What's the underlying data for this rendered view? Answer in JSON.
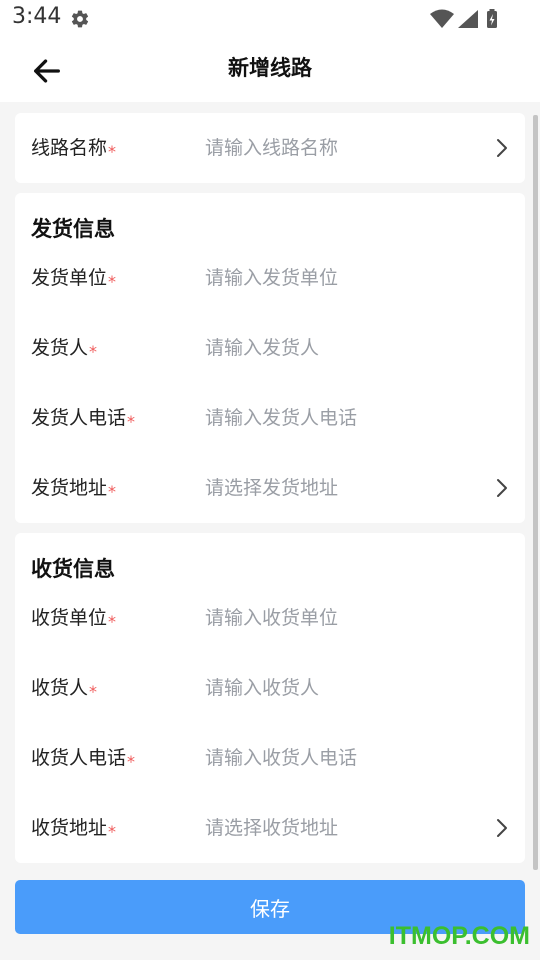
{
  "status_bar": {
    "time": "3:44",
    "icons": [
      "settings-icon",
      "wifi-icon",
      "signal-icon",
      "battery-icon"
    ]
  },
  "app_bar": {
    "title": "新增线路",
    "back_icon": "arrow-left-icon"
  },
  "route": {
    "name_label": "线路名称",
    "name_placeholder": "请输入线路名称",
    "required_mark": "*"
  },
  "shipper": {
    "section_title": "发货信息",
    "fields": [
      {
        "label": "发货单位",
        "placeholder": "请输入发货单位"
      },
      {
        "label": "发货人",
        "placeholder": "请输入发货人"
      },
      {
        "label": "发货人电话",
        "placeholder": "请输入发货人电话"
      },
      {
        "label": "发货地址",
        "placeholder": "请选择发货地址"
      }
    ]
  },
  "receiver": {
    "section_title": "收货信息",
    "fields": [
      {
        "label": "收货单位",
        "placeholder": "请输入收货单位"
      },
      {
        "label": "收货人",
        "placeholder": "请输入收货人"
      },
      {
        "label": "收货人电话",
        "placeholder": "请输入收货人电话"
      },
      {
        "label": "收货地址",
        "placeholder": "请选择收货地址"
      }
    ]
  },
  "save_label": "保存",
  "watermark": "ITMOP.COM",
  "colors": {
    "required": "#f05b5b",
    "primary": "#4a9cfa",
    "placeholder": "#9a9ea5",
    "page_bg": "#f5f5f5",
    "watermark": "#3bbf2f"
  }
}
